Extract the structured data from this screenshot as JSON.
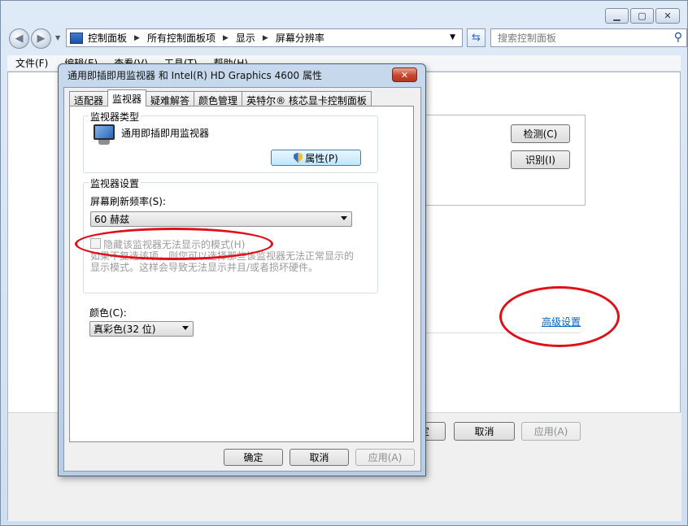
{
  "window": {
    "minimize_icon": "minimize-icon",
    "maximize_icon": "maximize-icon",
    "close_icon": "close-icon"
  },
  "address": {
    "crumbs": [
      "控制面板",
      "所有控制面板项",
      "显示",
      "屏幕分辨率"
    ],
    "search_placeholder": "搜索控制面板"
  },
  "menu": {
    "items": [
      "文件(F)",
      "编辑(E)",
      "查看(V)",
      "工具(T)",
      "帮助(H)"
    ]
  },
  "outer_panel": {
    "detect_label": "检测(C)",
    "identify_label": "识别(I)",
    "advanced_link": "高级设置",
    "ok_label": "确定",
    "cancel_label": "取消",
    "apply_label": "应用(A)"
  },
  "dialog": {
    "title": "通用即插即用监视器 和 Intel(R) HD Graphics 4600 属性",
    "tabs": [
      "适配器",
      "监视器",
      "疑难解答",
      "颜色管理",
      "英特尔® 核芯显卡控制面板"
    ],
    "active_tab": "监视器",
    "monitor_type_group": "监视器类型",
    "monitor_name": "通用即插即用监视器",
    "properties_button": "属性(P)",
    "monitor_settings_group": "监视器设置",
    "refresh_rate_label": "屏幕刷新频率(S):",
    "refresh_rate_value": "60 赫兹",
    "hide_modes_label": "隐藏该监视器无法显示的模式(H)",
    "hide_modes_help": "如果不复选该项，则您可以选择那些该监视器无法正常显示的显示模式。这样会导致无法显示并且/或者损坏硬件。",
    "colors_label": "颜色(C):",
    "colors_value": "真彩色(32 位)",
    "ok_label": "确定",
    "cancel_label": "取消",
    "apply_label": "应用(A)"
  },
  "colors": {
    "link": "#0066cc",
    "annotation": "#e0101a",
    "title_gradient": "#c7d8ec"
  }
}
